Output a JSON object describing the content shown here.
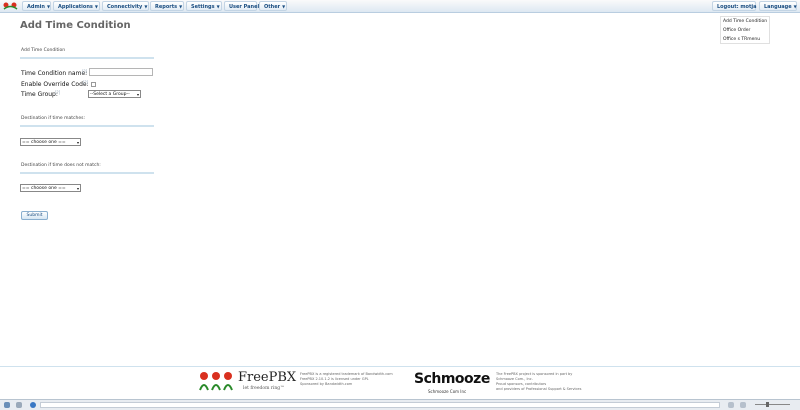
{
  "topnav": {
    "items": [
      {
        "label": "Admin"
      },
      {
        "label": "Applications"
      },
      {
        "label": "Connectivity"
      },
      {
        "label": "Reports"
      },
      {
        "label": "Settings"
      },
      {
        "label": "User Panel"
      },
      {
        "label": "Other"
      }
    ],
    "logout_label": "Logout: motja",
    "language_label": "Language"
  },
  "page": {
    "title": "Add Time Condition",
    "section_title": "Add Time Condition",
    "name_label": "Time Condition name:",
    "override_label": "Enable Override Code:",
    "group_label": "Time Group:",
    "group_value": "--Select a Group--",
    "dest_match_title": "Destination if time matches:",
    "dest_match_value": "== choose one ==",
    "dest_nomatch_title": "Destination if time does not match:",
    "dest_nomatch_value": "== choose one ==",
    "submit_label": "Submit",
    "help_mark": "[?]"
  },
  "right_nav": {
    "items": [
      {
        "label": "Add Time Condition"
      },
      {
        "label": "Office Order"
      },
      {
        "label": "Office s TRmenu"
      }
    ]
  },
  "footer": {
    "freepbx_name": "FreePBX",
    "freepbx_slogan": "let freedom ring™",
    "freepbx_lines": [
      "FreePBX is a registered trademark of Bandwidth.com",
      "FreePBX 2.10.1.2 is licensed under GPL",
      "Sponsored by Bandwidth.com"
    ],
    "schmooze_name": "Schmooze",
    "schmooze_sub": "Schmooze Com Inc",
    "schmooze_lines": [
      "The FreePBX project is sponsored in part by",
      "Schmooze Com., Inc.",
      "Proud sponsors, contributors",
      "and providers of Professional Support & Services"
    ]
  }
}
